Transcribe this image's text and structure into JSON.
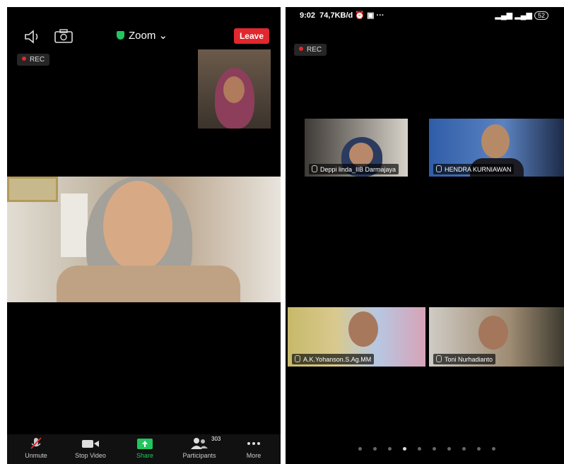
{
  "left_screen": {
    "topbar": {
      "app_label": "Zoom",
      "leave_label": "Leave"
    },
    "rec_label": "REC",
    "toolbar": [
      {
        "label": "Unmute",
        "icon": "mic-muted-icon"
      },
      {
        "label": "Stop Video",
        "icon": "video-camera-icon"
      },
      {
        "label": "Share",
        "icon": "share-up-arrow-icon"
      },
      {
        "label": "Participants",
        "icon": "people-icon",
        "badge": "303"
      },
      {
        "label": "More",
        "icon": "more-dots-icon"
      }
    ]
  },
  "right_screen": {
    "status": {
      "time": "9:02",
      "speed": "74,7KB/d",
      "battery": "52"
    },
    "rec_label": "REC",
    "participants": [
      "Deppi linda_IIB Darmajaya",
      "HENDRA KURNIAWAN",
      "A.K.Yohanson.S.Ag.MM",
      "Toni Nurhadianto"
    ],
    "page_count": 10,
    "active_page": 4
  },
  "colors": {
    "leave_red": "#e0282e",
    "share_green": "#22c55e",
    "secure_green": "#22c55e"
  }
}
